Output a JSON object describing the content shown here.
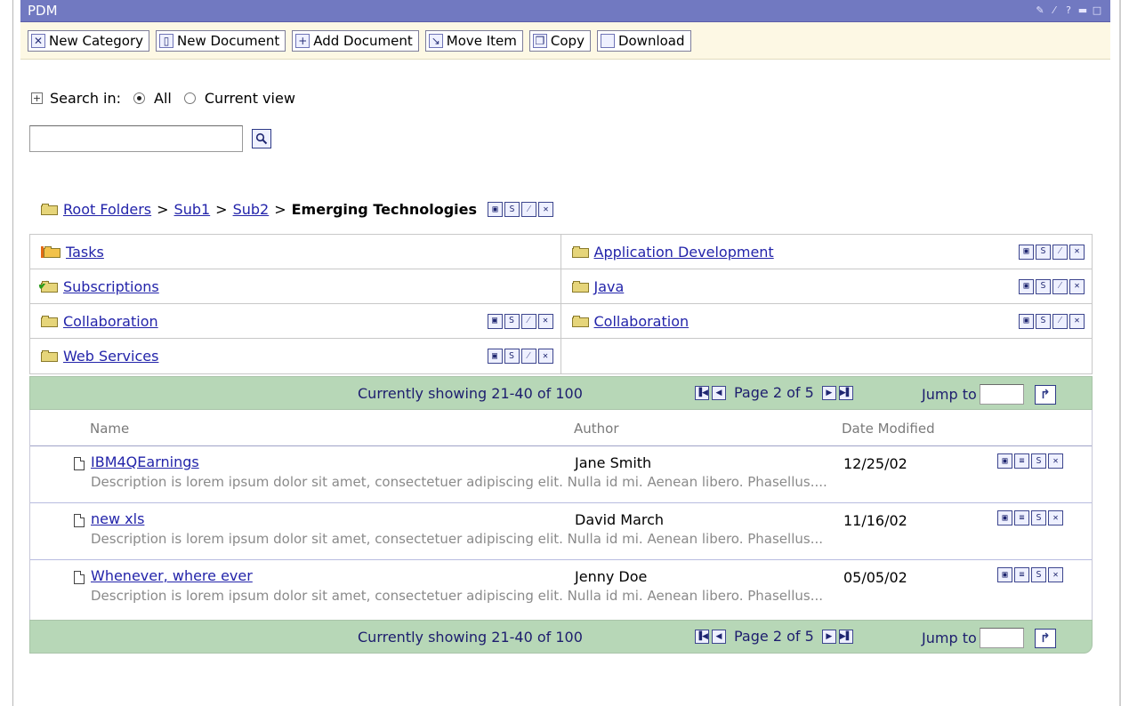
{
  "portlet": {
    "title": "PDM"
  },
  "title_icons": [
    "wrench-icon",
    "edit-icon",
    "help-icon",
    "minimize-icon",
    "maximize-icon"
  ],
  "toolbar": {
    "buttons": [
      {
        "label": "New Category",
        "icon": "new-category-icon"
      },
      {
        "label": "New Document",
        "icon": "new-document-icon"
      },
      {
        "label": "Add Document",
        "icon": "add-icon"
      },
      {
        "label": "Move Item",
        "icon": "move-icon"
      },
      {
        "label": "Copy",
        "icon": "copy-icon"
      },
      {
        "label": "Download",
        "icon": "download-icon"
      }
    ]
  },
  "search": {
    "label": "Search in:",
    "options": [
      "All",
      "Current view"
    ],
    "selected": "All",
    "value": ""
  },
  "breadcrumb": {
    "links": [
      "Root Folders",
      "Sub1",
      "Sub2"
    ],
    "separator": ">",
    "current": "Emerging Technologies"
  },
  "folders": [
    {
      "name": "Tasks",
      "icon": "tasks-folder-icon",
      "actions": false
    },
    {
      "name": "Application Development",
      "icon": "folder-icon",
      "actions": true
    },
    {
      "name": "Subscriptions",
      "icon": "subscriptions-folder-icon",
      "actions": false
    },
    {
      "name": "Java",
      "icon": "folder-icon",
      "actions": true
    },
    {
      "name": "Collaboration",
      "icon": "folder-icon",
      "actions": true
    },
    {
      "name": "Collaboration",
      "icon": "folder-icon",
      "actions": true
    },
    {
      "name": "Web Services",
      "icon": "folder-icon",
      "actions": true
    }
  ],
  "pager": {
    "showing": "Currently showing 21-40 of 100",
    "page": "Page 2 of 5",
    "jump_label": "Jump to",
    "jump_value": ""
  },
  "columns": {
    "name": "Name",
    "author": "Author",
    "date": "Date Modified"
  },
  "documents": [
    {
      "name": "IBM4QEarnings",
      "author": "Jane Smith",
      "date": "12/25/02",
      "description": "Description is lorem ipsum dolor sit amet, consectetuer adipiscing elit. Nulla id mi. Aenean libero. Phasellus...."
    },
    {
      "name": "new xls",
      "author": "David March",
      "date": "11/16/02",
      "description": "Description is lorem ipsum dolor sit amet, consectetuer adipiscing elit. Nulla id mi. Aenean libero. Phasellus..."
    },
    {
      "name": "Whenever, where ever",
      "author": "Jenny Doe",
      "date": "05/05/02",
      "description": "Description is lorem ipsum dolor sit amet, consectetuer adipiscing elit. Nulla id mi. Aenean libero. Phasellus..."
    }
  ],
  "colors": {
    "title_bar": "#7179c1",
    "toolbar_bg": "#fdf8e4",
    "pager_bg": "#b7d7b7",
    "link": "#2324aa"
  }
}
